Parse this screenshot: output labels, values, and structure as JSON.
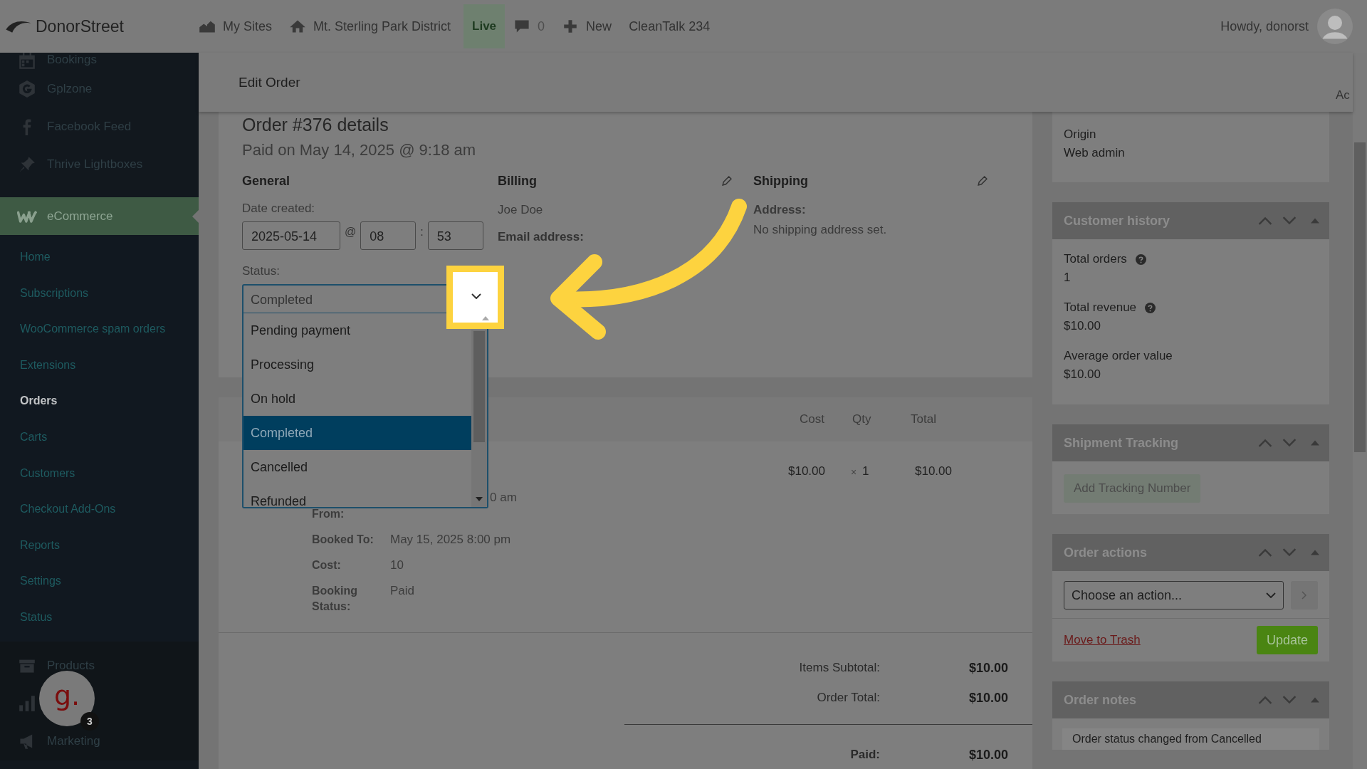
{
  "topbar": {
    "logo": "DonorStreet",
    "items": [
      {
        "label": "My Sites",
        "kind": "sites"
      },
      {
        "label": "Mt. Sterling Park District",
        "kind": "home"
      },
      {
        "label": "Live",
        "kind": "badge"
      },
      {
        "label": "0",
        "kind": "comments"
      },
      {
        "label": "New",
        "kind": "new"
      },
      {
        "label": "CleanTalk 234",
        "kind": "plain"
      }
    ],
    "greeting": "Howdy, donorst"
  },
  "screen_options": "Ac",
  "sidebar": {
    "items": [
      {
        "label": "Bookings"
      },
      {
        "label": "Gplzone"
      },
      {
        "label": "Facebook Feed"
      },
      {
        "label": "Thrive Lightboxes"
      }
    ],
    "active": {
      "label": "eCommerce"
    },
    "submenu": [
      {
        "label": "Home",
        "selected": false
      },
      {
        "label": "Subscriptions",
        "selected": false
      },
      {
        "label": "WooCommerce spam orders",
        "selected": false
      },
      {
        "label": "Extensions",
        "selected": false
      },
      {
        "label": "Orders",
        "selected": true
      },
      {
        "label": "Carts",
        "selected": false
      },
      {
        "label": "Customers",
        "selected": false
      },
      {
        "label": "Checkout Add-Ons",
        "selected": false
      },
      {
        "label": "Reports",
        "selected": false
      },
      {
        "label": "Settings",
        "selected": false
      },
      {
        "label": "Status",
        "selected": false
      }
    ],
    "lower": [
      {
        "label": "Products",
        "kind": "labeled"
      },
      {
        "kind": "icon-only"
      },
      {
        "label": "Marketing",
        "kind": "labeled"
      }
    ]
  },
  "chat_widget": {
    "letter": "g.",
    "badge": "3"
  },
  "header": {
    "title": "Edit Order"
  },
  "order": {
    "title": "Order #376 details",
    "subtitle": "Paid on May 14, 2025 @ 9:18 am",
    "general": {
      "heading": "General",
      "date_label": "Date created:",
      "date": "2025-05-14",
      "at": "@",
      "hour": "08",
      "colon": ":",
      "minute": "53",
      "status_label": "Status:",
      "status": {
        "value": "Completed",
        "expanded": true,
        "options": [
          {
            "label": "Pending payment",
            "selected": false
          },
          {
            "label": "Processing",
            "selected": false
          },
          {
            "label": "On hold",
            "selected": false
          },
          {
            "label": "Completed",
            "selected": true
          },
          {
            "label": "Cancelled",
            "selected": false
          },
          {
            "label": "Refunded",
            "selected": false
          }
        ]
      }
    },
    "billing": {
      "heading": "Billing",
      "name": "Joe Doe",
      "email_label": "Email address:"
    },
    "shipping": {
      "heading": "Shipping",
      "address_label": "Address:",
      "address": "No shipping address set."
    }
  },
  "items": {
    "columns": [
      "Cost",
      "Qty",
      "Total"
    ],
    "row": {
      "cost": "$10.00",
      "qty_sign": "×",
      "qty": "1",
      "total": "$10.00"
    },
    "meta": [
      {
        "label": "From:",
        "value": "0 am"
      },
      {
        "label": "Booked To:",
        "value": "May 15, 2025 8:00 pm"
      },
      {
        "label": "Cost:",
        "value": "10"
      },
      {
        "label": "Booking Status:",
        "value": "Paid"
      }
    ],
    "totals": [
      {
        "label": "Items Subtotal:",
        "value": "$10.00",
        "kind": "plain"
      },
      {
        "label": "Order Total:",
        "value": "$10.00",
        "kind": "plain"
      },
      {
        "label": "Paid:",
        "value": "$10.00",
        "kind": "paid"
      }
    ]
  },
  "origin": {
    "label": "Origin",
    "value": "Web admin"
  },
  "customer_history": {
    "title": "Customer history",
    "stats": [
      {
        "label": "Total orders",
        "value": "1",
        "help": true
      },
      {
        "label": "Total revenue",
        "value": "$10.00",
        "help": true
      },
      {
        "label": "Average order value",
        "value": "$10.00",
        "help": false
      }
    ]
  },
  "shipment_tracking": {
    "title": "Shipment Tracking",
    "button": "Add Tracking Number"
  },
  "order_actions": {
    "title": "Order actions",
    "placeholder": "Choose an action...",
    "trash": "Move to Trash",
    "update": "Update"
  },
  "order_notes": {
    "title": "Order notes",
    "notes": [
      "Order status changed from Cancelled"
    ]
  }
}
